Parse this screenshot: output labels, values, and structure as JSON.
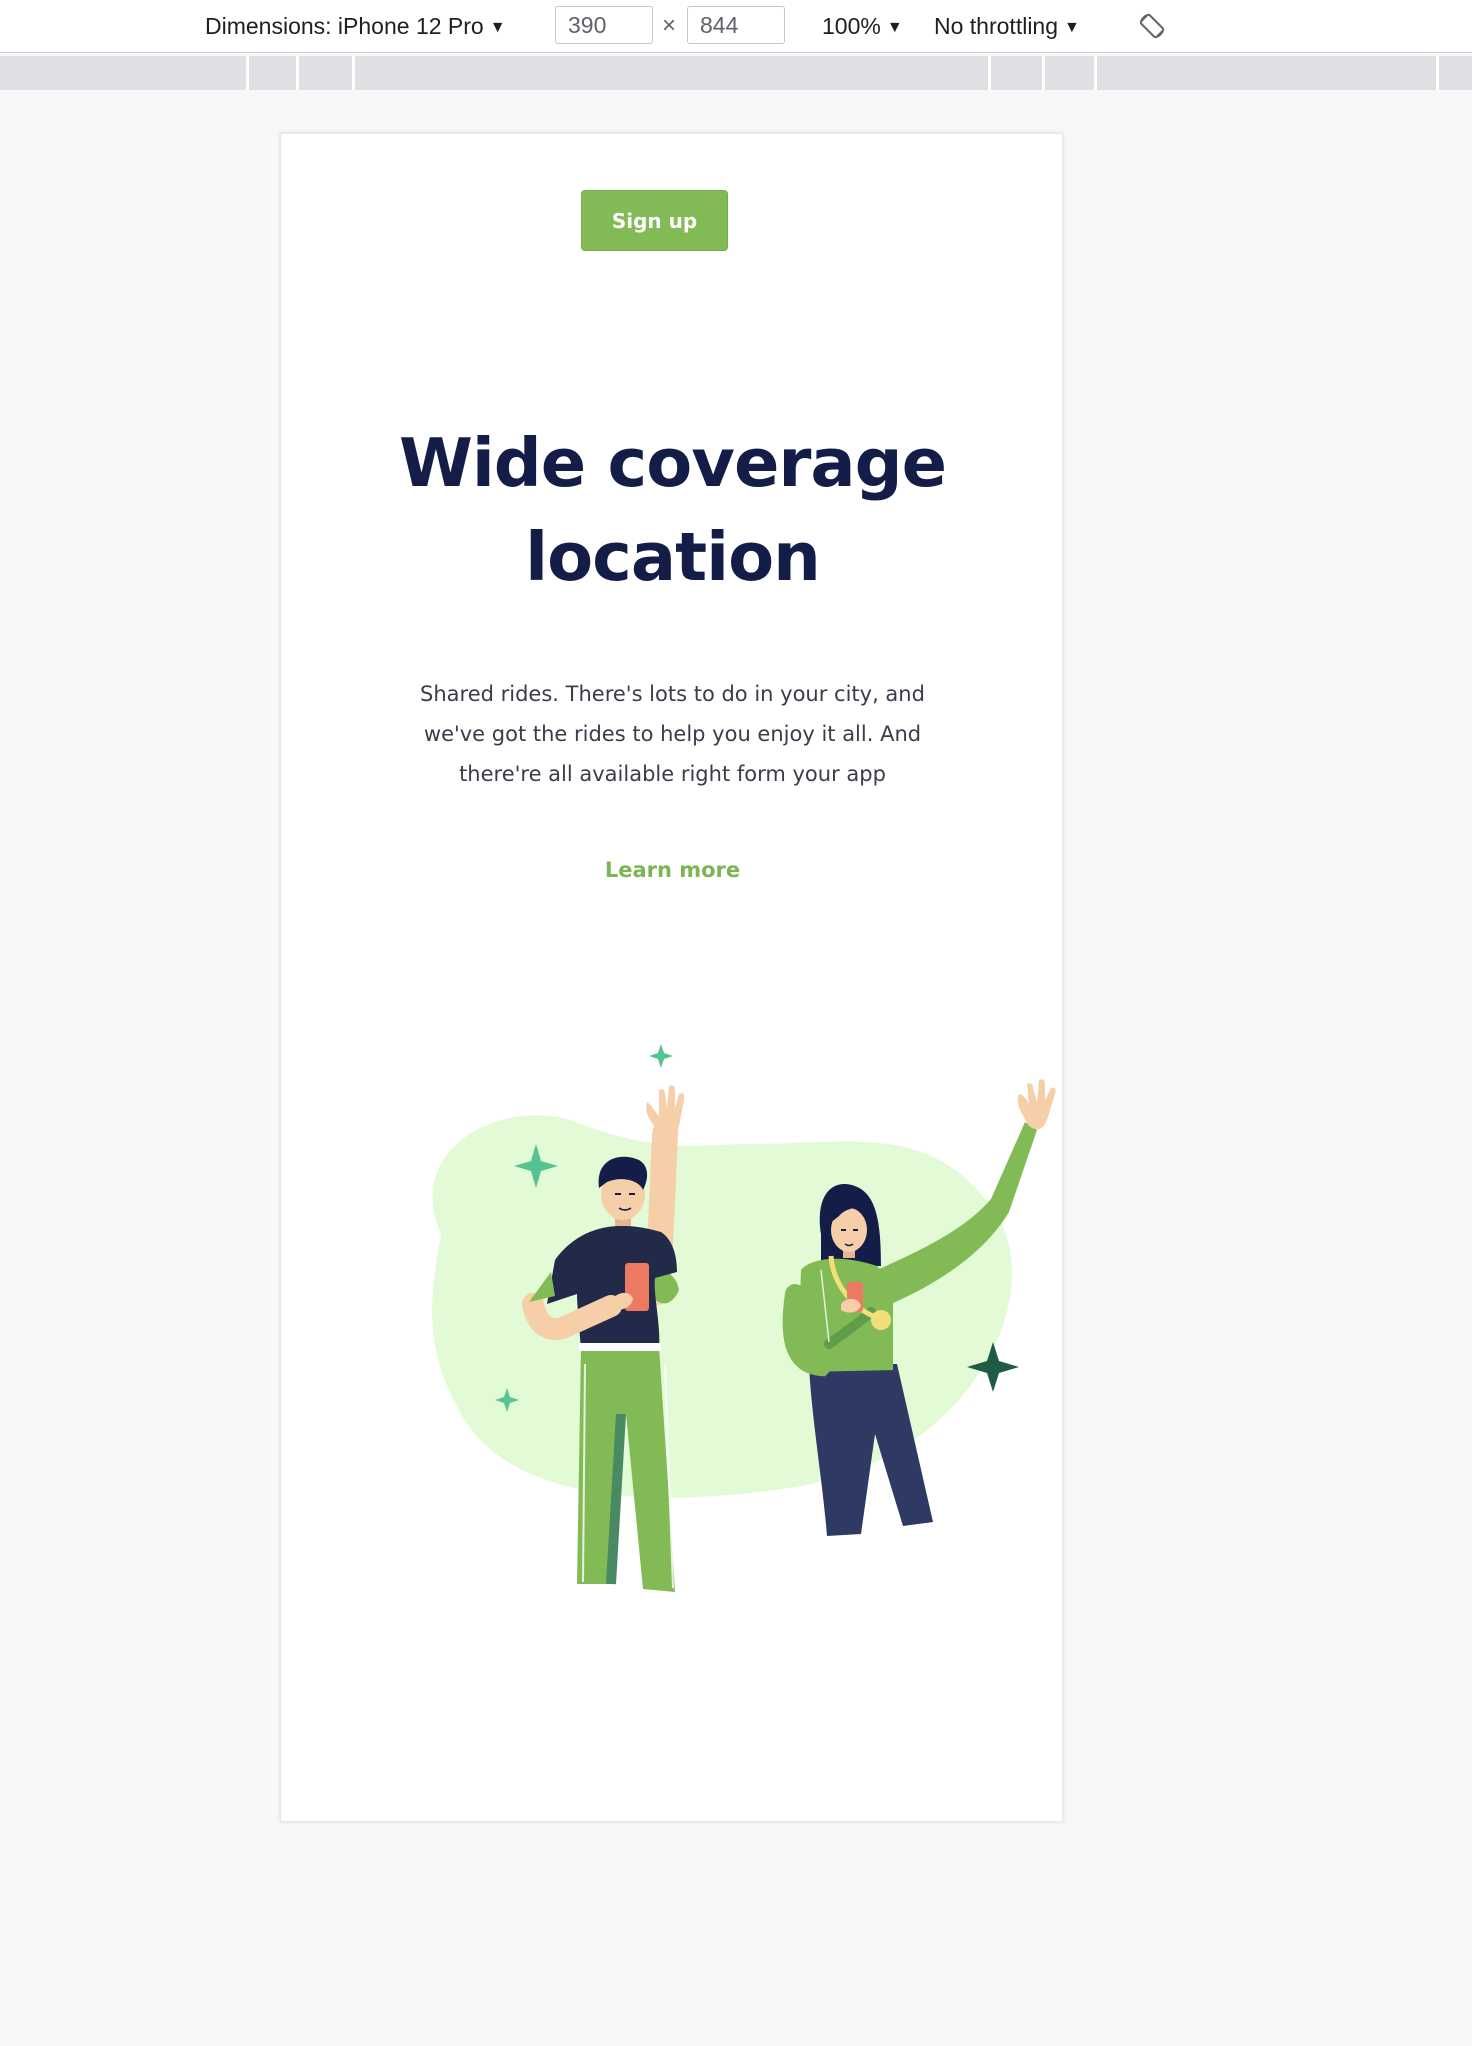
{
  "devtools": {
    "dimensions_label": "Dimensions: iPhone 12 Pro",
    "width_value": "390",
    "height_value": "844",
    "times_symbol": "×",
    "zoom_label": "100%",
    "throttling_label": "No throttling",
    "dropdown_arrow": "▼",
    "rotate_icon": "rotate-device-icon"
  },
  "page": {
    "signup_label": "Sign up",
    "title_line1": "Wide coverage",
    "title_line2": "location",
    "description": "Shared rides. There's lots to do in your city, and we've got the rides to help you enjoy it all. And there're all available right form your app",
    "learn_more_label": "Learn more"
  },
  "colors": {
    "accent_green": "#82bb55",
    "title_navy": "#141d48",
    "blob_light_green": "#e2fbd6",
    "sparkle_teal": "#55c392",
    "sparkle_dark": "#1f5b45"
  }
}
